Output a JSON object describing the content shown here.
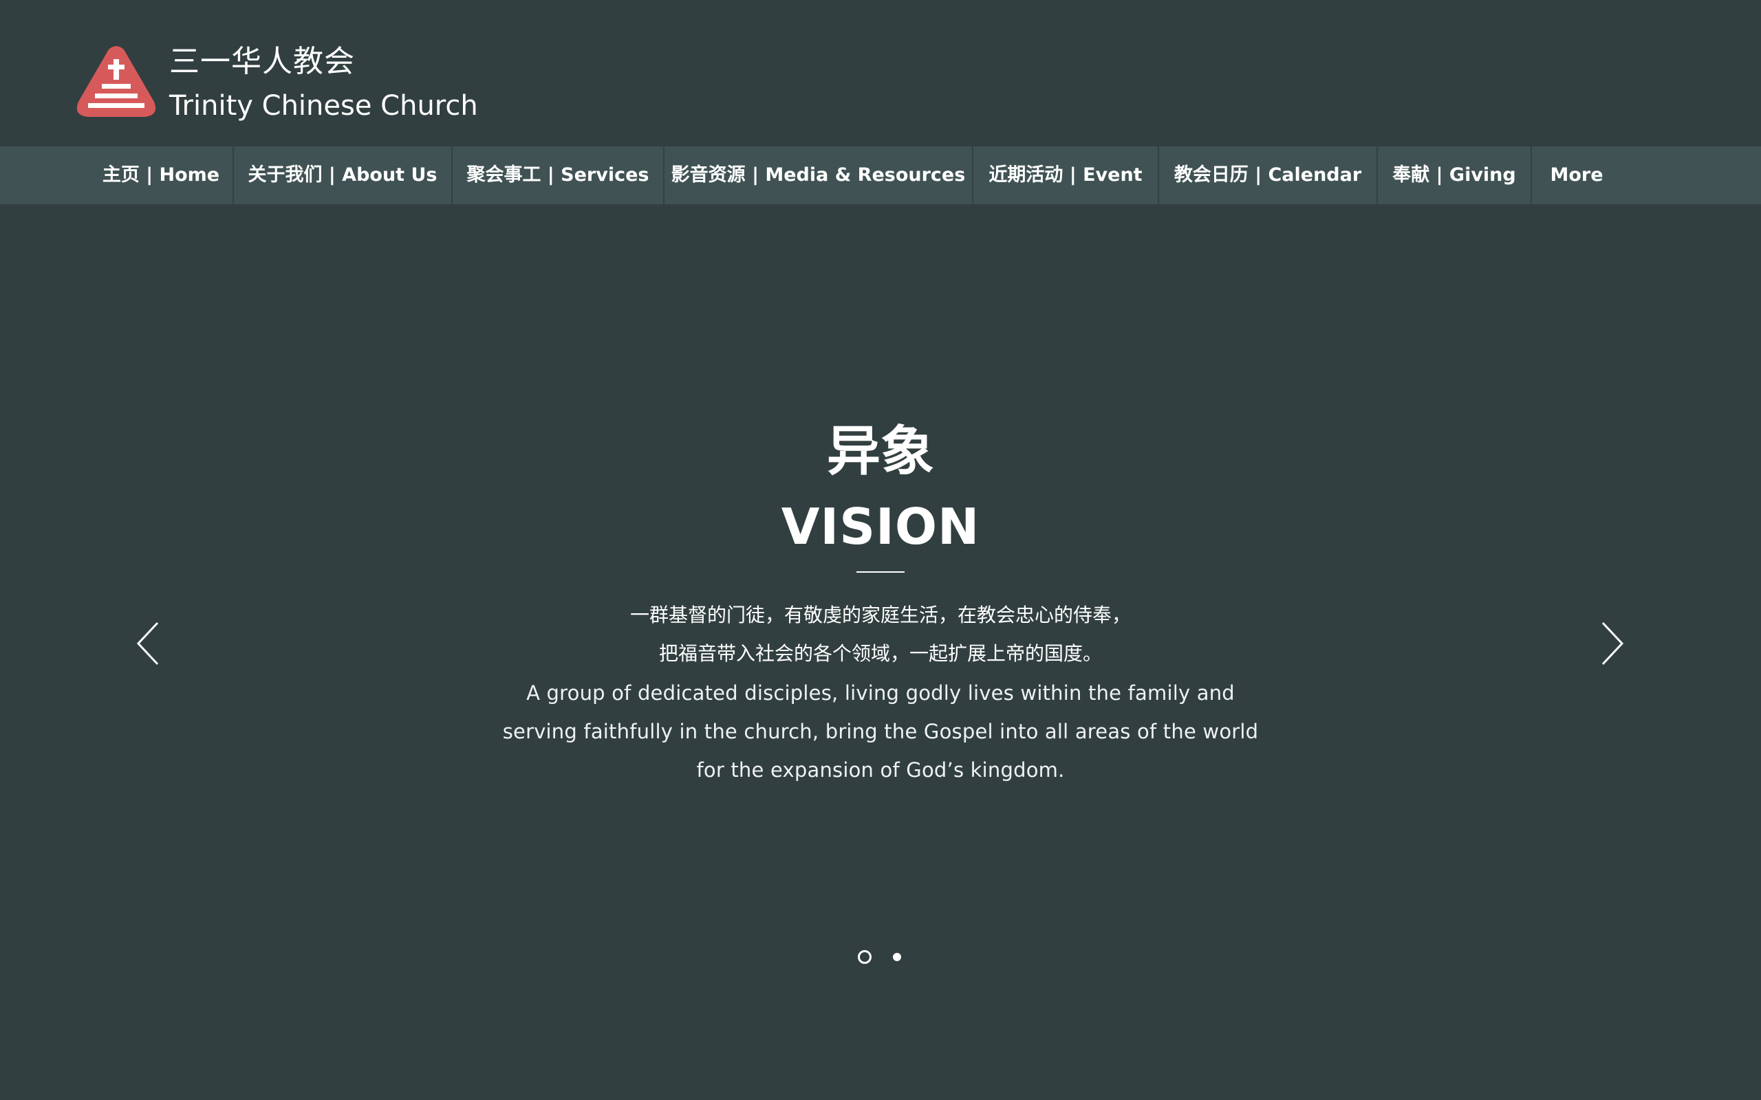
{
  "brand": {
    "name_cn": "三一华人教会",
    "name_en": "Trinity Chinese Church",
    "logo_icon": "church-cross-logo-icon",
    "logo_color": "#d75a5a"
  },
  "nav": {
    "items": [
      {
        "label": "主页 | Home"
      },
      {
        "label": "关于我们 | About Us"
      },
      {
        "label": "聚会事工 | Services"
      },
      {
        "label": "影音资源 | Media & Resources"
      },
      {
        "label": "近期活动 | Event"
      },
      {
        "label": "教会日历 | Calendar"
      },
      {
        "label": "奉献 | Giving"
      },
      {
        "label": "More"
      }
    ]
  },
  "slide": {
    "title_cn": "异象",
    "title_en": "VISION",
    "body_cn": [
      "一群基督的门徒，有敬虔的家庭生活，在教会忠心的侍奉，",
      "把福音带入社会的各个领域，一起扩展上帝的国度。"
    ],
    "body_en": [
      "A group of dedicated disciples, living godly lives within the family and",
      "serving faithfully in the church, bring the Gospel into all areas of the world",
      "for the expansion of God’s kingdom."
    ],
    "prev_icon": "chevron-left-icon",
    "next_icon": "chevron-right-icon",
    "slide_count": 2,
    "current_slide": 1
  },
  "colors": {
    "background": "#323f40",
    "nav_background": "#405253",
    "text": "#ffffff"
  }
}
